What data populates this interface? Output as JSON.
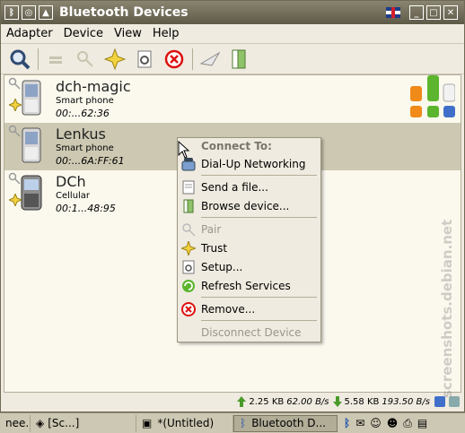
{
  "window": {
    "title": "Bluetooth Devices"
  },
  "menu": {
    "items": [
      "Adapter",
      "Device",
      "View",
      "Help"
    ]
  },
  "devices": [
    {
      "name": "dch-magic",
      "type": "Smart phone",
      "address": "00:...62:36"
    },
    {
      "name": "Lenkus",
      "type": "Smart phone",
      "address": "00:...6A:FF:61"
    },
    {
      "name": "DCh",
      "type": "Cellular",
      "address": "00:1...48:95"
    }
  ],
  "context_menu": {
    "header": "Connect To:",
    "items": {
      "dialup": "Dial-Up Networking",
      "send_file": "Send a file...",
      "browse": "Browse device...",
      "pair": "Pair",
      "trust": "Trust",
      "setup": "Setup...",
      "refresh": "Refresh Services",
      "remove": "Remove...",
      "disconnect": "Disconnect Device"
    }
  },
  "status": {
    "up_total": "2.25 KB",
    "up_rate": "62.00 B/s",
    "down_total": "5.58 KB",
    "down_rate": "193.50 B/s"
  },
  "taskbar": {
    "tasks": [
      "nee...",
      "[Sc...]",
      "*(Untitled)",
      "Bluetooth D..."
    ]
  },
  "watermark": "screenshots.debian.net",
  "colors": {
    "titlebar": "#6e6a56",
    "selection": "#ccc8b2"
  }
}
